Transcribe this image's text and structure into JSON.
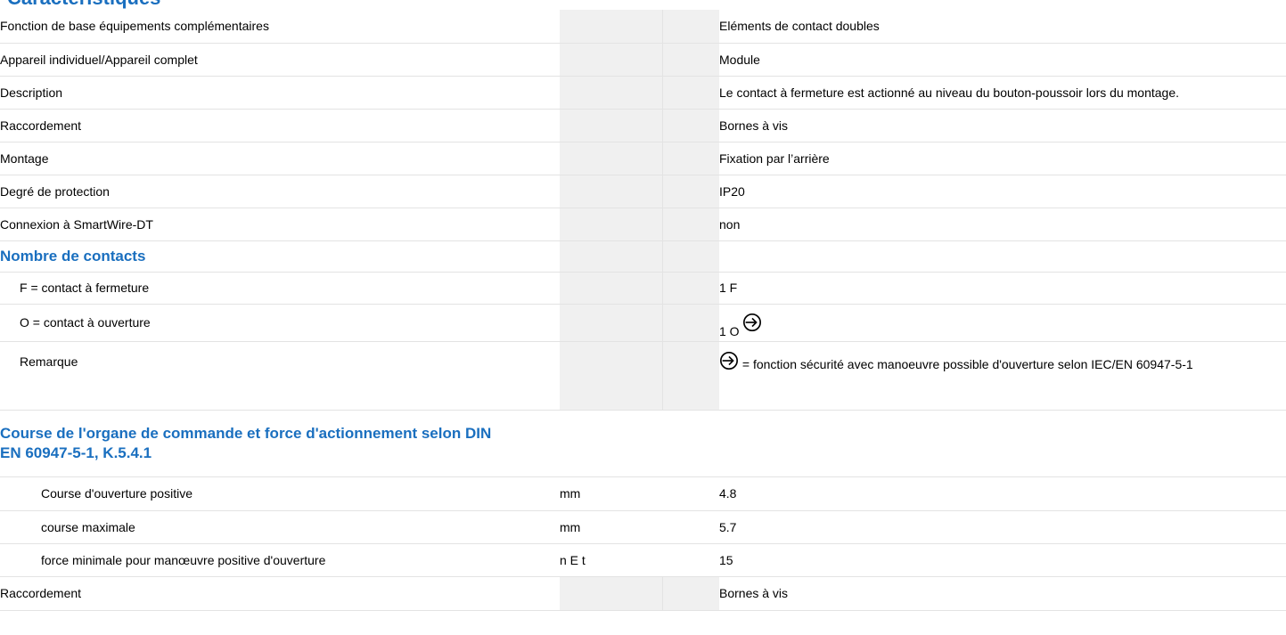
{
  "top_heading": "Caractéristiques",
  "rows": {
    "fonction": {
      "label": "Fonction de base équipements complémentaires",
      "value": "Eléments de contact doubles"
    },
    "appareil": {
      "label": "Appareil individuel/Appareil complet",
      "value": "Module"
    },
    "description": {
      "label": "Description",
      "value": "Le contact à fermeture est actionné au niveau du bouton-poussoir lors du montage."
    },
    "raccordement": {
      "label": "Raccordement",
      "value": "Bornes à vis"
    },
    "montage": {
      "label": "Montage",
      "value": "Fixation par l’arrière"
    },
    "protection": {
      "label": "Degré de protection",
      "value": "IP20"
    },
    "smartwire": {
      "label": "Connexion à SmartWire-DT",
      "value": "non"
    },
    "nombre_heading": {
      "label": "Nombre de contacts"
    },
    "f_contact": {
      "label": "F = contact à fermeture",
      "value": "1 F"
    },
    "o_contact": {
      "label": "O = contact à ouverture",
      "value": "1 O"
    },
    "remarque": {
      "label": "Remarque",
      "value": "= fonction sécurité avec manoeuvre possible d'ouverture selon IEC/EN 60947-5-1"
    },
    "course_heading": {
      "label": "Course de l'organe de commande et force d'actionnement selon DIN EN 60947-5-1, K.5.4.1"
    },
    "course_ouverture": {
      "label": "Course d'ouverture positive",
      "unit": "mm",
      "value": "4.8"
    },
    "course_max": {
      "label": "course maximale",
      "unit": "mm",
      "value": "5.7"
    },
    "force_min": {
      "label": "force minimale pour manœuvre positive d'ouverture",
      "unit": "n E t",
      "value": "15"
    },
    "raccordement2": {
      "label": "Raccordement",
      "value": "Bornes à vis"
    }
  },
  "icons": {
    "positive_opening": "positive-opening-symbol-icon"
  },
  "colors": {
    "heading_blue": "#1a6fbf",
    "unit_column_gray": "#f0f0f0",
    "row_border": "#e3e3e3"
  }
}
